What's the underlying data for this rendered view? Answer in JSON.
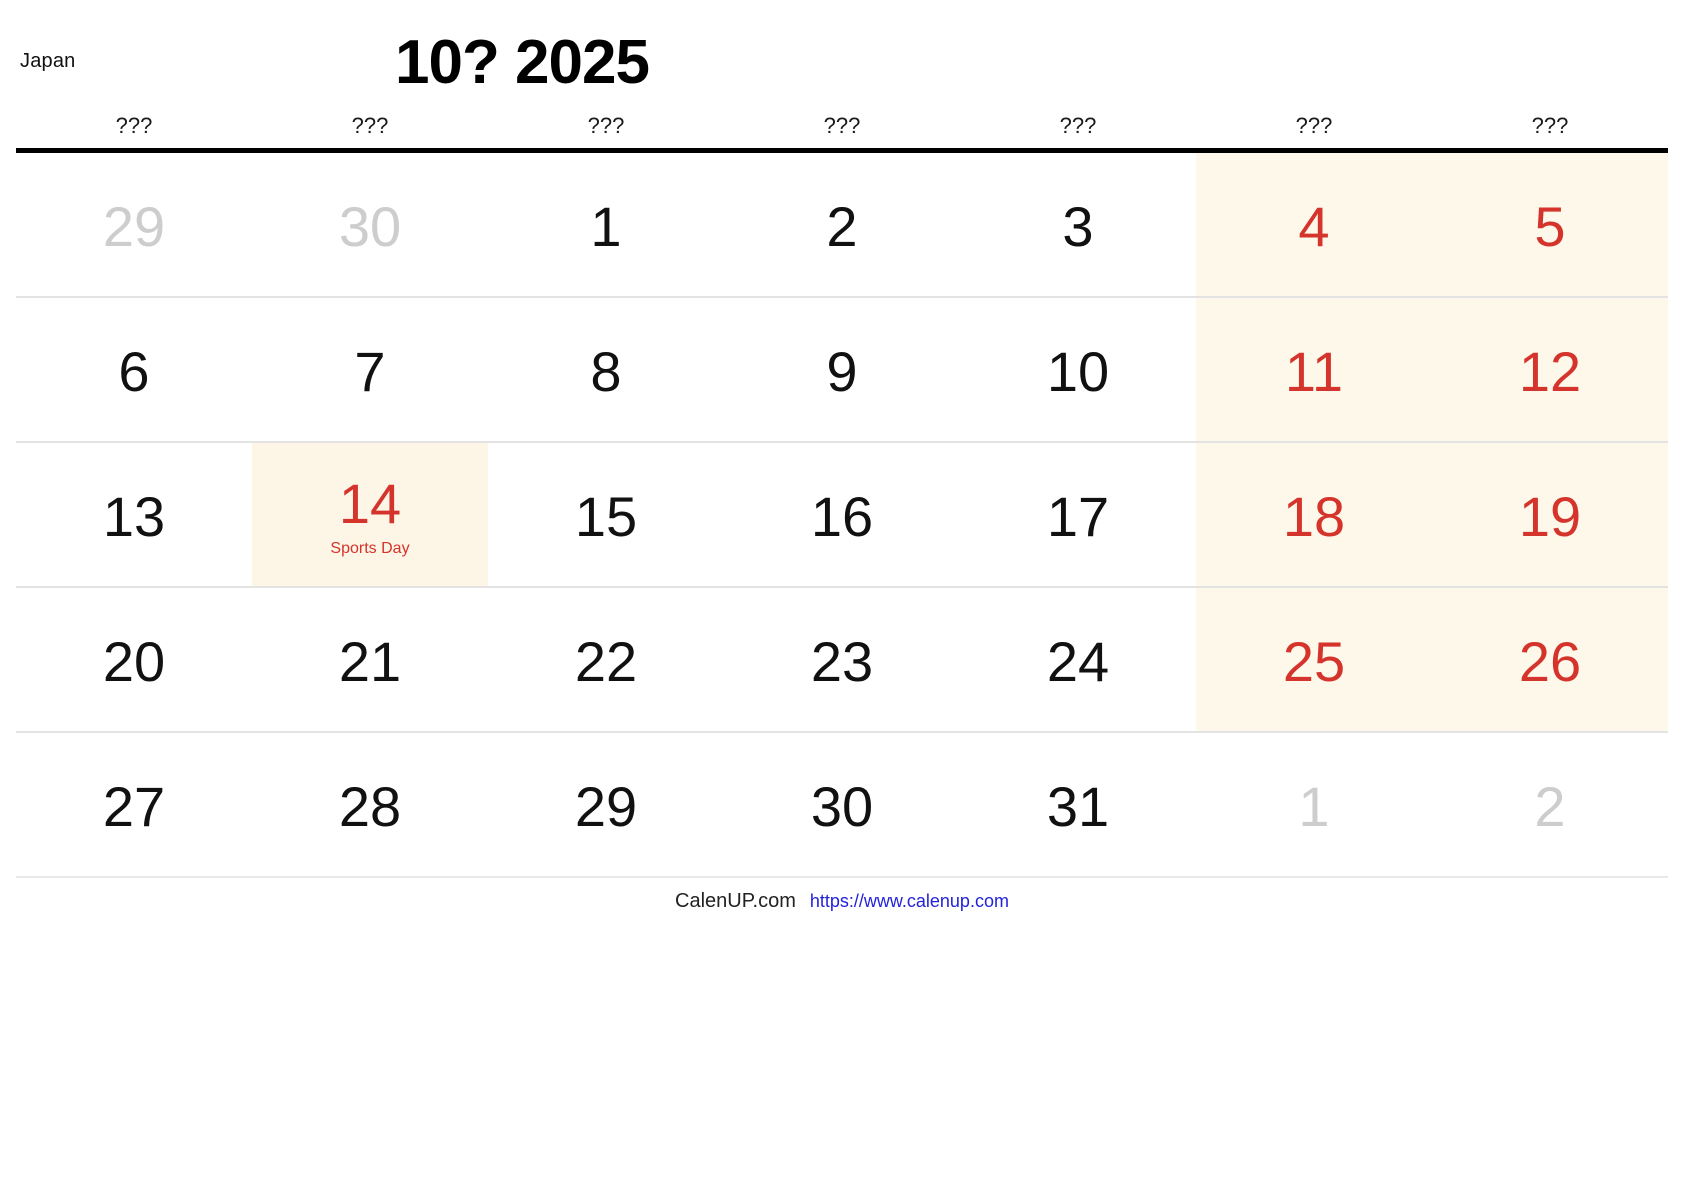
{
  "header": {
    "region_label": "Japan",
    "title": "10? 2025",
    "month_number": 10,
    "year": 2025
  },
  "weekdays": [
    "???",
    "???",
    "???",
    "???",
    "???",
    "???",
    "???"
  ],
  "colors": {
    "holiday_red": "#d4342c",
    "weekend_bg": "#fdf8e9",
    "muted_day": "#cdcdcd",
    "rule": "#000000",
    "link": "#2222dd"
  },
  "weeks": [
    [
      {
        "num": "29",
        "style": "muted",
        "bg": "none",
        "event": ""
      },
      {
        "num": "30",
        "style": "muted",
        "bg": "none",
        "event": ""
      },
      {
        "num": "1",
        "style": "normal",
        "bg": "none",
        "event": ""
      },
      {
        "num": "2",
        "style": "normal",
        "bg": "none",
        "event": ""
      },
      {
        "num": "3",
        "style": "normal",
        "bg": "none",
        "event": ""
      },
      {
        "num": "4",
        "style": "red",
        "bg": "weekend",
        "event": ""
      },
      {
        "num": "5",
        "style": "red",
        "bg": "weekend",
        "event": ""
      }
    ],
    [
      {
        "num": "6",
        "style": "normal",
        "bg": "none",
        "event": ""
      },
      {
        "num": "7",
        "style": "normal",
        "bg": "none",
        "event": ""
      },
      {
        "num": "8",
        "style": "normal",
        "bg": "none",
        "event": ""
      },
      {
        "num": "9",
        "style": "normal",
        "bg": "none",
        "event": ""
      },
      {
        "num": "10",
        "style": "normal",
        "bg": "none",
        "event": ""
      },
      {
        "num": "11",
        "style": "red",
        "bg": "weekend",
        "event": ""
      },
      {
        "num": "12",
        "style": "red",
        "bg": "weekend",
        "event": ""
      }
    ],
    [
      {
        "num": "13",
        "style": "normal",
        "bg": "none",
        "event": ""
      },
      {
        "num": "14",
        "style": "red",
        "bg": "holiday",
        "event": "Sports Day"
      },
      {
        "num": "15",
        "style": "normal",
        "bg": "none",
        "event": ""
      },
      {
        "num": "16",
        "style": "normal",
        "bg": "none",
        "event": ""
      },
      {
        "num": "17",
        "style": "normal",
        "bg": "none",
        "event": ""
      },
      {
        "num": "18",
        "style": "red",
        "bg": "weekend",
        "event": ""
      },
      {
        "num": "19",
        "style": "red",
        "bg": "weekend",
        "event": ""
      }
    ],
    [
      {
        "num": "20",
        "style": "normal",
        "bg": "none",
        "event": ""
      },
      {
        "num": "21",
        "style": "normal",
        "bg": "none",
        "event": ""
      },
      {
        "num": "22",
        "style": "normal",
        "bg": "none",
        "event": ""
      },
      {
        "num": "23",
        "style": "normal",
        "bg": "none",
        "event": ""
      },
      {
        "num": "24",
        "style": "normal",
        "bg": "none",
        "event": ""
      },
      {
        "num": "25",
        "style": "red",
        "bg": "weekend",
        "event": ""
      },
      {
        "num": "26",
        "style": "red",
        "bg": "weekend",
        "event": ""
      }
    ],
    [
      {
        "num": "27",
        "style": "normal",
        "bg": "none",
        "event": ""
      },
      {
        "num": "28",
        "style": "normal",
        "bg": "none",
        "event": ""
      },
      {
        "num": "29",
        "style": "normal",
        "bg": "none",
        "event": ""
      },
      {
        "num": "30",
        "style": "normal",
        "bg": "none",
        "event": ""
      },
      {
        "num": "31",
        "style": "normal",
        "bg": "none",
        "event": ""
      },
      {
        "num": "1",
        "style": "muted",
        "bg": "none",
        "event": ""
      },
      {
        "num": "2",
        "style": "muted",
        "bg": "none",
        "event": ""
      }
    ]
  ],
  "footer": {
    "brand": "CalenUP.com",
    "url": "https://www.calenup.com"
  }
}
